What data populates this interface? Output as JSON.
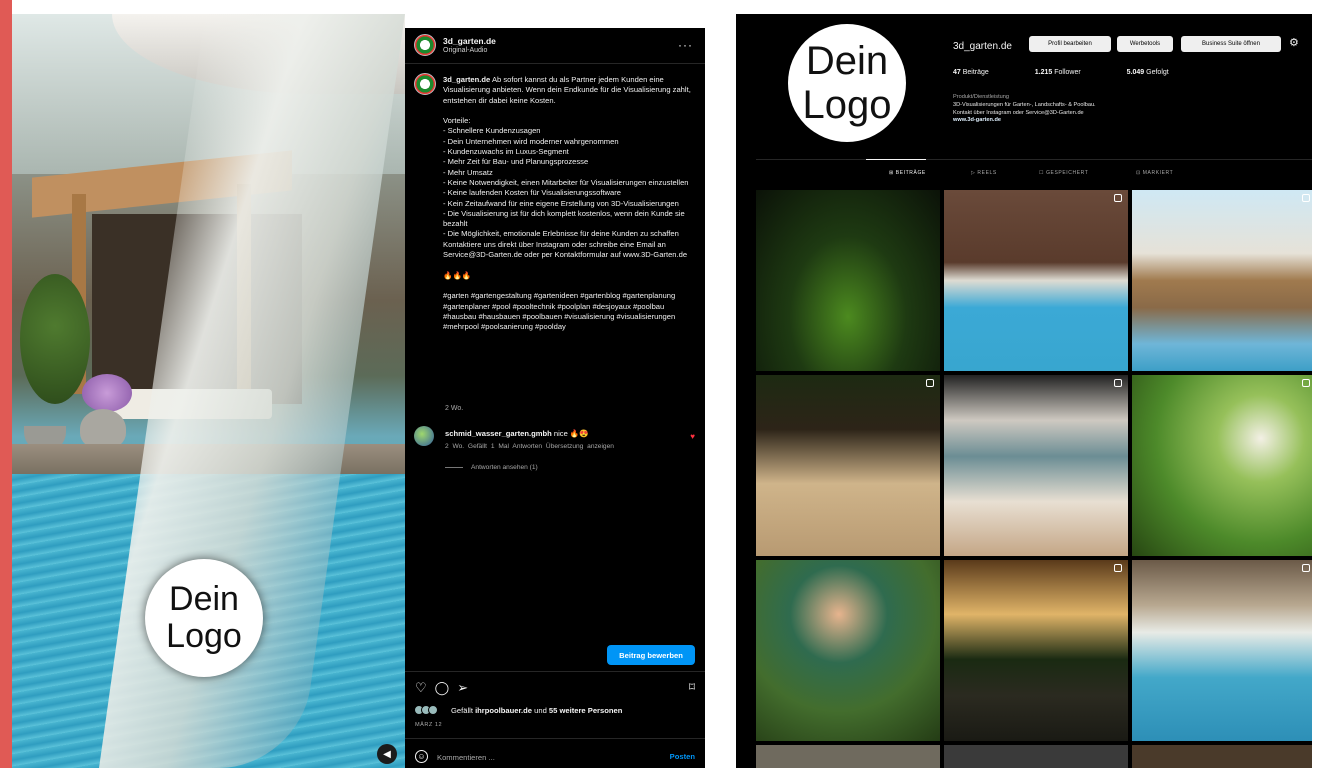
{
  "post": {
    "header": {
      "username": "3d_garten.de",
      "audio": "Original-Audio",
      "more": "···"
    },
    "caption": {
      "username": "3d_garten.de",
      "text": " Ab sofort kannst du als Partner jedem Kunden eine Visualisierung anbieten. Wenn dein Endkunde für die Visualisierung zahlt, entstehen dir dabei keine Kosten.\n\nVorteile:\n- Schnellere Kundenzusagen\n- Dein Unternehmen wird moderner wahrgenommen\n- Kundenzuwachs im Luxus-Segment\n- Mehr Zeit für Bau- und Planungsprozesse\n- Mehr Umsatz\n- Keine Notwendigkeit, einen Mitarbeiter für Visualisierungen einzustellen\n- Keine laufenden Kosten für Visualisierungssoftware\n- Kein Zeitaufwand für eine eigene Erstellung von 3D-Visualisierungen\n- Die Visualisierung ist für dich komplett kostenlos, wenn dein Kunde sie bezahlt\n- Die Möglichkeit, emotionale Erlebnisse für deine Kunden zu schaffen\nKontaktiere uns direkt über Instagram oder schreibe eine Email an Service@3D-Garten.de oder per Kontaktformular auf www.3D-Garten.de\n\n🔥🔥🔥\n\n#garten #gartengestaltung #gartenideen #gartenblog #gartenplanung #gartenplaner #pool #pooltechnik #poolplan #desjoyaux #poolbau #hausbau #hausbauen #poolbauen #visualisierung #visualisierungen #mehrpool #poolsanierung #poolday",
      "age": "2 Wo."
    },
    "comment": {
      "username": "schmid_wasser_garten.gmbh",
      "text": " nice 🔥😍",
      "meta": "2 Wo.  Gefällt 1 Mal  Antworten  Übersetzung anzeigen",
      "replies": "Antworten ansehen (1)"
    },
    "promote_label": "Beitrag bewerben",
    "likes": {
      "prefix": "Gefällt ",
      "user": "ihrpoolbauer.de",
      "middle": " und ",
      "others": "55 weitere Personen"
    },
    "date": "MÄRZ 12",
    "comment_placeholder": "Kommentieren ...",
    "post_label": "Posten",
    "logo_line1": "Dein",
    "logo_line2": "Logo"
  },
  "profile": {
    "logo_line1": "Dein",
    "logo_line2": "Logo",
    "username": "3d_garten.de",
    "buttons": [
      "Profil bearbeiten",
      "Werbetools",
      "Business Suite öffnen"
    ],
    "stats": {
      "posts_num": "47",
      "posts_label": " Beiträge",
      "followers_num": "1.215",
      "followers_label": " Follower",
      "following_num": "5.049",
      "following_label": " Gefolgt"
    },
    "bio": {
      "category": "Produkt/Dienstleistung",
      "line1": "3D-Visualisierungen für Garten-, Landschafts- & Poolbau.",
      "line2": "Kontakt über Instagram oder Service@3D-Garten.de",
      "link": "www.3d-garten.de"
    },
    "tabs": [
      "⊞ BEITRÄGE",
      "▷ REELS",
      "☐ GESPEICHERT",
      "⊡ MARKIERT"
    ]
  },
  "colors": {
    "accent_strip": "#e05a55",
    "promote_blue": "#0095f6",
    "heart": "#ff3040"
  },
  "icons": [
    "volume-icon",
    "more-icon",
    "heart-icon",
    "comment-icon",
    "share-icon",
    "bookmark-icon",
    "emoji-icon",
    "gear-icon"
  ]
}
